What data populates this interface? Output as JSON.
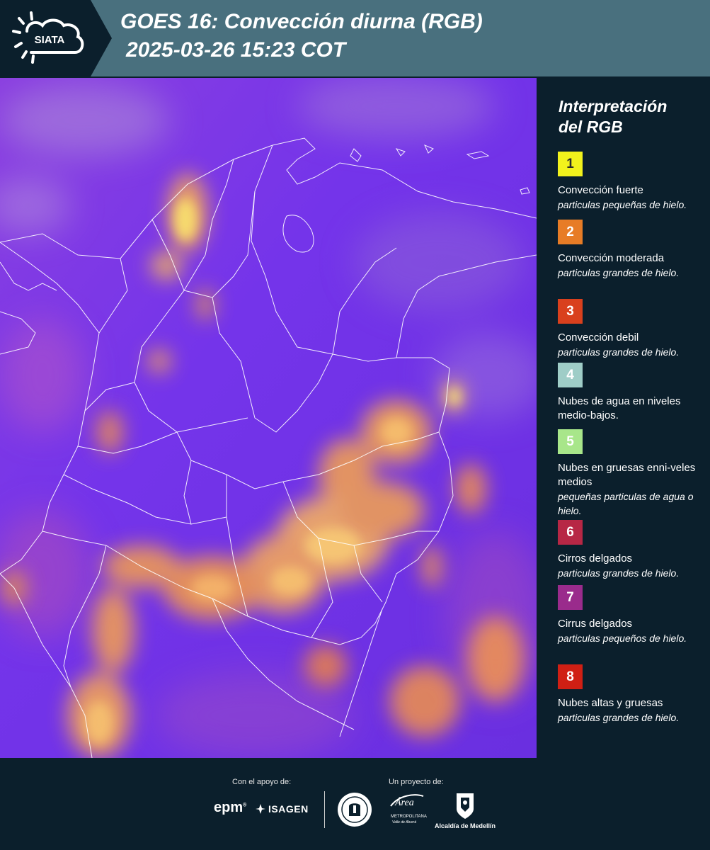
{
  "header": {
    "logo_text": "SIATA",
    "title": "GOES 16: Convección diurna (RGB)",
    "datetime": "2025-03-26 15:23 COT"
  },
  "legend": {
    "title_line1": "Interpretación",
    "title_line2": "del RGB",
    "entries": [
      {
        "number": "1",
        "color": "#f2f21c",
        "number_color": "#2a2a2a",
        "line1": "Convección fuerte",
        "line2": "particulas pequeñas de hielo."
      },
      {
        "number": "2",
        "color": "#e77c26",
        "number_color": "#ffffff",
        "line1": "Convección moderada",
        "line2": "particulas grandes de hielo."
      },
      {
        "number": "3",
        "color": "#d9401d",
        "number_color": "#ffffff",
        "line1": "Convección debil",
        "line2": "particulas grandes de hielo."
      },
      {
        "number": "4",
        "color": "#9fcdc7",
        "number_color": "#ffffff",
        "line1": "Nubes de agua en niveles medio-bajos.",
        "line2": ""
      },
      {
        "number": "5",
        "color": "#a8e68a",
        "number_color": "#ffffff",
        "line1": "Nubes en gruesas enni-veles medios",
        "line2": "pequeñas particulas de agua o hielo."
      },
      {
        "number": "6",
        "color": "#b72745",
        "number_color": "#ffffff",
        "line1": "Cirros delgados",
        "line2": "particulas grandes de hielo."
      },
      {
        "number": "7",
        "color": "#9a2b8c",
        "number_color": "#ffffff",
        "line1": "Cirrus delgados",
        "line2": "particulas pequeños de hielo."
      },
      {
        "number": "8",
        "color": "#d01f14",
        "number_color": "#ffffff",
        "line1": "Nubes altas y gruesas",
        "line2": "particulas grandes de hielo."
      }
    ]
  },
  "footer": {
    "support_label": "Con el apoyo de:",
    "project_label": "Un proyecto de:",
    "sponsor_1": "epm",
    "sponsor_1_mark": "®",
    "sponsor_2": "ISAGEN",
    "partner_area_1": "Área",
    "partner_area_2": "METROPOLITANA",
    "partner_area_3": "Valle de Aburrá",
    "partner_medellin": "Alcaldía de Medellín"
  },
  "colors": {
    "background": "#0b1f2c",
    "header_band": "#49707e",
    "map_base": "#7b36e6"
  }
}
